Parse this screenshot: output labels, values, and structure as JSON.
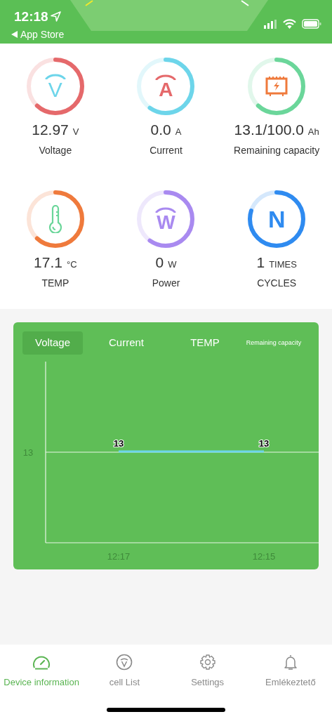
{
  "status_bar": {
    "time": "12:18",
    "back_label": "App Store"
  },
  "gauges": [
    {
      "kind": "letter",
      "symbol": "V",
      "value": "12.97",
      "unit": "V",
      "label": "Voltage",
      "color": "#e5696b"
    },
    {
      "kind": "letter",
      "symbol": "A",
      "value": "0.0",
      "unit": "A",
      "label": "Current",
      "color": "#6dd5ea"
    },
    {
      "kind": "battery",
      "value": "13.1/100.0",
      "unit": "Ah",
      "label": "Remaining capacity",
      "color": "#6bd69a"
    },
    {
      "kind": "thermometer",
      "value": "17.1",
      "unit": "°C",
      "label": "TEMP",
      "color": "#ef7a3c"
    },
    {
      "kind": "letter",
      "symbol": "W",
      "value": "0",
      "unit": "W",
      "label": "Power",
      "color": "#a98af0"
    },
    {
      "kind": "letter",
      "symbol": "N",
      "value": "1",
      "unit": "TIMES",
      "label": "CYCLES",
      "color": "#2f8bf0"
    }
  ],
  "chart_tabs": [
    {
      "label": "Voltage",
      "selected": true
    },
    {
      "label": "Current",
      "selected": false
    },
    {
      "label": "TEMP",
      "selected": false
    },
    {
      "label": "Remaining capacity",
      "selected": false
    }
  ],
  "chart": {
    "y_axis_label": "13",
    "point_labels": [
      "13",
      "13"
    ],
    "x_axis_labels": [
      "12:17",
      "12:15"
    ]
  },
  "nav": [
    {
      "label": "Device information",
      "selected": true
    },
    {
      "label": "cell List",
      "selected": false
    },
    {
      "label": "Settings",
      "selected": false
    },
    {
      "label": "Emlékeztető",
      "selected": false
    }
  ]
}
